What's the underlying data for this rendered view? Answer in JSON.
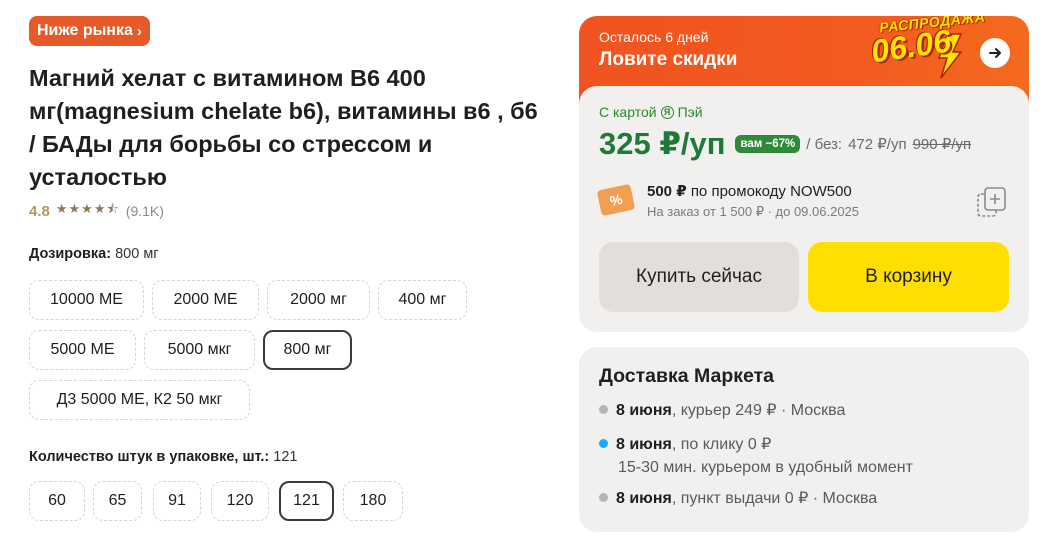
{
  "badge": {
    "label": "Ниже рынка"
  },
  "product": {
    "title": "Магний хелат с витамином B6 400 мг(magnesium chelate b6), витамины в6 , б6 / БАДы для борьбы со стрессом и усталостью",
    "rating": "4.8",
    "rating_stars": 4.5,
    "reviews": "(9.1K)"
  },
  "dosage": {
    "label": "Дозировка:",
    "value": "800 мг",
    "options": [
      "10000 МЕ",
      "2000 МЕ",
      "2000 мг",
      "400 мг",
      "5000 МЕ",
      "5000 мкг",
      "800 мг",
      "Д3 5000 МЕ, К2 50 мкг"
    ],
    "selected": "800 мг"
  },
  "quantity": {
    "label": "Количество штук в упаковке, шт.:",
    "value": "121",
    "options": [
      "60",
      "65",
      "91",
      "120",
      "121",
      "180"
    ],
    "selected": "121"
  },
  "promo_banner": {
    "days_left": "Осталось 6 дней",
    "catch_phrase": "Ловите скидки",
    "sale_word": "РАСПРОДАЖА",
    "sale_date": "06.06",
    "color": "#f0531f"
  },
  "price": {
    "card_label": "С картой",
    "card_brand": "Пэй",
    "current": "325 ₽/уп",
    "discount": "вам −67%",
    "without_card_prefix": "/ без:",
    "without_card": "472 ₽/уп",
    "old_price": "990 ₽/уп"
  },
  "promocode": {
    "icon": "%",
    "amount": "500 ₽",
    "text": "по промокоду NOW500",
    "conditions": "На заказ от 1 500 ₽ · до 09.06.2025"
  },
  "buttons": {
    "buy_now": "Купить сейчас",
    "add_to_cart": "В корзину"
  },
  "delivery": {
    "title": "Доставка Маркета",
    "items": [
      {
        "date": "8 июня",
        "rest": ", курьер 249 ₽ · Москва",
        "dot_color": "#b5b5b5"
      },
      {
        "date": "8 июня",
        "rest": ", по клику 0 ₽",
        "sub": "15-30 мин. курьером в удобный момент",
        "dot_color": "#1fa8ef"
      },
      {
        "date": "8 июня",
        "rest": ", пункт выдачи 0 ₽ · Москва",
        "dot_color": "#b5b5b5"
      }
    ]
  }
}
